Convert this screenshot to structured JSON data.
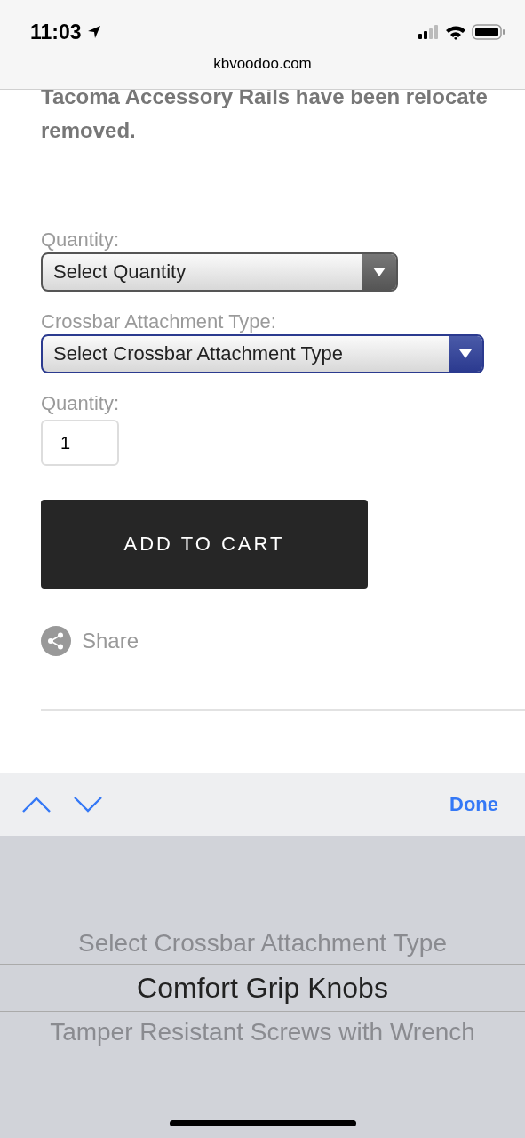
{
  "status_bar": {
    "time": "11:03",
    "url": "kbvoodoo.com"
  },
  "notice_lines": [
    "Tacoma Accessory Rails have been relocate",
    "removed."
  ],
  "form": [
    {
      "kind": "select",
      "label": "Quantity:",
      "value": "Select Quantity",
      "focused": false
    },
    {
      "kind": "select",
      "label": "Crossbar Attachment Type:",
      "value": "Select Crossbar Attachment Type",
      "focused": true
    },
    {
      "kind": "input",
      "label": "Quantity:",
      "value": "1"
    }
  ],
  "add_to_cart": "ADD TO CART",
  "share": "Share",
  "keyboard_toolbar": {
    "done": "Done"
  },
  "picker": [
    {
      "label": "Select Crossbar Attachment Type",
      "selected": false
    },
    {
      "label": "Comfort Grip Knobs",
      "selected": true
    },
    {
      "label": "Tamper Resistant Screws with Wrench",
      "selected": false
    }
  ]
}
